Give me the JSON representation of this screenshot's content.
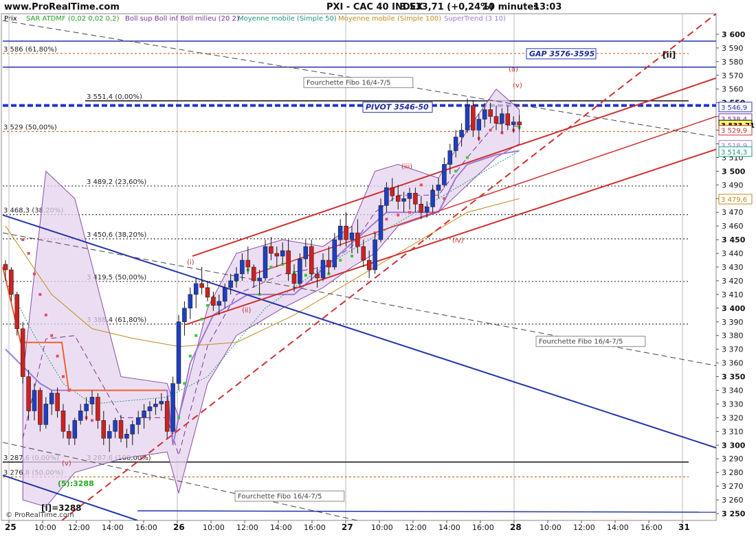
{
  "header": {
    "site": "www.ProRealTime.com",
    "title": "PXI - CAC 40 INDEX",
    "last": "3 533,71 (+0,24%)",
    "timeframe": "10 minutes",
    "time": "13:03"
  },
  "legend": [
    {
      "label": "Prix",
      "color": "#000000"
    },
    {
      "label": "SAR ATDMF (0,02 0,02 0,2)",
      "color": "#22a022"
    },
    {
      "label": "Boll sup Boll inf Boll milieu (20 2)",
      "color": "#7a2f9a"
    },
    {
      "label": "Moyenne mobile (Simple 50)",
      "color": "#1a9a7a"
    },
    {
      "label": "Moyenne mobile (Simple 100)",
      "color": "#c08a1a"
    },
    {
      "label": "SuperTrend (3 10)",
      "color": "#9a7ad8"
    }
  ],
  "copyright": "© ProRealTime.com",
  "chart_data": {
    "type": "candlestick",
    "ylim": [
      3245,
      3615
    ],
    "y_ticks": [
      3250,
      3260,
      3270,
      3280,
      3290,
      3300,
      3310,
      3320,
      3330,
      3340,
      3350,
      3360,
      3370,
      3380,
      3390,
      3400,
      3410,
      3420,
      3430,
      3440,
      3450,
      3460,
      3470,
      3480,
      3490,
      3500,
      3510,
      3520,
      3530,
      3540,
      3550,
      3560,
      3570,
      3580,
      3590,
      3600
    ],
    "x_ticks": [
      {
        "label": "25",
        "bold": true
      },
      {
        "label": "10:00"
      },
      {
        "label": "12:00"
      },
      {
        "label": "14:00"
      },
      {
        "label": "16:00"
      },
      {
        "label": "26",
        "bold": true
      },
      {
        "label": "10:00"
      },
      {
        "label": "12:00"
      },
      {
        "label": "14:00"
      },
      {
        "label": "16:00"
      },
      {
        "label": "27",
        "bold": true
      },
      {
        "label": "10:00"
      },
      {
        "label": "12:00"
      },
      {
        "label": "14:00"
      },
      {
        "label": "16:00"
      },
      {
        "label": "28",
        "bold": true
      },
      {
        "label": "10:00"
      },
      {
        "label": "12:00"
      },
      {
        "label": "14:00"
      },
      {
        "label": "16:00"
      },
      {
        "label": "31",
        "bold": true
      }
    ],
    "candles": [
      [
        3432,
        3435,
        3420,
        3428
      ],
      [
        3428,
        3430,
        3405,
        3410
      ],
      [
        3410,
        3412,
        3380,
        3385
      ],
      [
        3385,
        3390,
        3345,
        3350
      ],
      [
        3350,
        3355,
        3318,
        3325
      ],
      [
        3325,
        3345,
        3318,
        3340
      ],
      [
        3340,
        3342,
        3310,
        3315
      ],
      [
        3315,
        3335,
        3312,
        3330
      ],
      [
        3330,
        3340,
        3322,
        3338
      ],
      [
        3338,
        3342,
        3320,
        3325
      ],
      [
        3325,
        3330,
        3305,
        3310
      ],
      [
        3310,
        3315,
        3300,
        3305
      ],
      [
        3305,
        3320,
        3300,
        3318
      ],
      [
        3318,
        3330,
        3315,
        3325
      ],
      [
        3325,
        3335,
        3318,
        3330
      ],
      [
        3330,
        3340,
        3322,
        3335
      ],
      [
        3335,
        3338,
        3312,
        3318
      ],
      [
        3318,
        3325,
        3300,
        3305
      ],
      [
        3305,
        3315,
        3295,
        3310
      ],
      [
        3310,
        3320,
        3305,
        3318
      ],
      [
        3318,
        3322,
        3302,
        3305
      ],
      [
        3305,
        3312,
        3298,
        3308
      ],
      [
        3308,
        3318,
        3300,
        3315
      ],
      [
        3315,
        3325,
        3308,
        3320
      ],
      [
        3320,
        3330,
        3312,
        3325
      ],
      [
        3325,
        3332,
        3318,
        3328
      ],
      [
        3328,
        3334,
        3322,
        3330
      ],
      [
        3330,
        3338,
        3325,
        3332
      ],
      [
        3332,
        3336,
        3305,
        3310
      ],
      [
        3310,
        3350,
        3308,
        3345
      ],
      [
        3345,
        3395,
        3340,
        3390
      ],
      [
        3390,
        3405,
        3380,
        3400
      ],
      [
        3400,
        3415,
        3392,
        3410
      ],
      [
        3410,
        3422,
        3400,
        3418
      ],
      [
        3418,
        3430,
        3410,
        3415
      ],
      [
        3415,
        3420,
        3405,
        3408
      ],
      [
        3408,
        3412,
        3398,
        3402
      ],
      [
        3402,
        3410,
        3395,
        3405
      ],
      [
        3405,
        3418,
        3400,
        3415
      ],
      [
        3415,
        3425,
        3410,
        3420
      ],
      [
        3420,
        3430,
        3415,
        3425
      ],
      [
        3425,
        3440,
        3420,
        3435
      ],
      [
        3435,
        3445,
        3425,
        3430
      ],
      [
        3430,
        3432,
        3415,
        3420
      ],
      [
        3420,
        3428,
        3410,
        3422
      ],
      [
        3422,
        3450,
        3420,
        3445
      ],
      [
        3445,
        3452,
        3435,
        3440
      ],
      [
        3440,
        3445,
        3430,
        3438
      ],
      [
        3438,
        3448,
        3432,
        3442
      ],
      [
        3442,
        3450,
        3420,
        3425
      ],
      [
        3425,
        3432,
        3412,
        3418
      ],
      [
        3418,
        3440,
        3415,
        3436
      ],
      [
        3436,
        3450,
        3430,
        3445
      ],
      [
        3445,
        3450,
        3420,
        3425
      ],
      [
        3425,
        3430,
        3415,
        3422
      ],
      [
        3422,
        3440,
        3420,
        3435
      ],
      [
        3435,
        3445,
        3425,
        3430
      ],
      [
        3430,
        3455,
        3428,
        3450
      ],
      [
        3450,
        3465,
        3445,
        3460
      ],
      [
        3460,
        3470,
        3445,
        3450
      ],
      [
        3450,
        3460,
        3440,
        3455
      ],
      [
        3455,
        3465,
        3440,
        3445
      ],
      [
        3445,
        3450,
        3430,
        3435
      ],
      [
        3435,
        3442,
        3422,
        3428
      ],
      [
        3428,
        3455,
        3425,
        3450
      ],
      [
        3450,
        3480,
        3448,
        3475
      ],
      [
        3475,
        3492,
        3470,
        3488
      ],
      [
        3488,
        3495,
        3478,
        3482
      ],
      [
        3482,
        3490,
        3472,
        3478
      ],
      [
        3478,
        3485,
        3470,
        3480
      ],
      [
        3480,
        3488,
        3472,
        3484
      ],
      [
        3484,
        3488,
        3470,
        3476
      ],
      [
        3476,
        3482,
        3465,
        3470
      ],
      [
        3470,
        3478,
        3466,
        3474
      ],
      [
        3474,
        3490,
        3470,
        3486
      ],
      [
        3486,
        3495,
        3480,
        3490
      ],
      [
        3490,
        3510,
        3488,
        3505
      ],
      [
        3505,
        3520,
        3498,
        3515
      ],
      [
        3515,
        3530,
        3510,
        3525
      ],
      [
        3525,
        3535,
        3518,
        3530
      ],
      [
        3530,
        3553,
        3528,
        3548
      ],
      [
        3548,
        3552,
        3525,
        3530
      ],
      [
        3530,
        3542,
        3522,
        3538
      ],
      [
        3538,
        3550,
        3532,
        3545
      ],
      [
        3545,
        3550,
        3535,
        3540
      ],
      [
        3540,
        3548,
        3530,
        3535
      ],
      [
        3535,
        3546,
        3528,
        3542
      ],
      [
        3542,
        3548,
        3530,
        3534
      ],
      [
        3534,
        3540,
        3528,
        3536
      ],
      [
        3536,
        3541,
        3530,
        3533.71
      ]
    ],
    "bollinger_upper": [
      [
        3,
        3350
      ],
      [
        7,
        3500
      ],
      [
        12,
        3480
      ],
      [
        20,
        3350
      ],
      [
        28,
        3345
      ],
      [
        30,
        3320
      ],
      [
        35,
        3400
      ],
      [
        40,
        3440
      ],
      [
        48,
        3450
      ],
      [
        55,
        3445
      ],
      [
        60,
        3460
      ],
      [
        64,
        3500
      ],
      [
        68,
        3505
      ],
      [
        75,
        3495
      ],
      [
        80,
        3530
      ],
      [
        85,
        3560
      ],
      [
        89,
        3545
      ]
    ],
    "bollinger_lower": [
      [
        3,
        3260
      ],
      [
        7,
        3255
      ],
      [
        12,
        3280
      ],
      [
        20,
        3290
      ],
      [
        28,
        3295
      ],
      [
        30,
        3265
      ],
      [
        35,
        3345
      ],
      [
        40,
        3380
      ],
      [
        48,
        3400
      ],
      [
        55,
        3415
      ],
      [
        60,
        3430
      ],
      [
        64,
        3440
      ],
      [
        68,
        3460
      ],
      [
        75,
        3470
      ],
      [
        80,
        3490
      ],
      [
        85,
        3510
      ],
      [
        89,
        3520
      ]
    ],
    "sma50": [
      [
        0,
        3420
      ],
      [
        5,
        3380
      ],
      [
        10,
        3345
      ],
      [
        15,
        3330
      ],
      [
        20,
        3332
      ],
      [
        28,
        3335
      ],
      [
        35,
        3350
      ],
      [
        45,
        3400
      ],
      [
        55,
        3430
      ],
      [
        65,
        3455
      ],
      [
        75,
        3480
      ],
      [
        85,
        3505
      ],
      [
        89,
        3515
      ]
    ],
    "sma100": [
      [
        0,
        3460
      ],
      [
        8,
        3410
      ],
      [
        15,
        3385
      ],
      [
        22,
        3378
      ],
      [
        30,
        3372
      ],
      [
        40,
        3375
      ],
      [
        50,
        3395
      ],
      [
        60,
        3420
      ],
      [
        70,
        3445
      ],
      [
        80,
        3470
      ],
      [
        89,
        3480
      ]
    ],
    "supertrend": [
      [
        0,
        3370
      ],
      [
        6,
        3345
      ],
      [
        8,
        3340
      ],
      [
        28,
        3340
      ],
      [
        29,
        3300
      ],
      [
        32,
        3360
      ],
      [
        36,
        3395
      ],
      [
        42,
        3410
      ],
      [
        50,
        3410
      ],
      [
        58,
        3440
      ],
      [
        66,
        3470
      ],
      [
        75,
        3470
      ],
      [
        78,
        3495
      ],
      [
        80,
        3505
      ],
      [
        85,
        3512
      ],
      [
        89,
        3515
      ]
    ],
    "sar_points": [
      [
        3,
        3450
      ],
      [
        4,
        3440
      ],
      [
        5,
        3425
      ],
      [
        6,
        3410
      ],
      [
        7,
        3395
      ],
      [
        8,
        3380
      ],
      [
        9,
        3365
      ],
      [
        10,
        3350
      ],
      [
        11,
        3340
      ],
      [
        14,
        3320
      ],
      [
        15,
        3318
      ],
      [
        16,
        3320
      ],
      [
        30,
        3320
      ],
      [
        31,
        3345
      ],
      [
        32,
        3365
      ],
      [
        33,
        3380
      ],
      [
        34,
        3392
      ],
      [
        35,
        3402
      ],
      [
        36,
        3408
      ],
      [
        38,
        3410
      ],
      [
        40,
        3420
      ],
      [
        42,
        3428
      ],
      [
        44,
        3410
      ],
      [
        46,
        3430
      ],
      [
        48,
        3432
      ],
      [
        50,
        3426
      ],
      [
        52,
        3424
      ],
      [
        56,
        3425
      ],
      [
        58,
        3435
      ],
      [
        60,
        3438
      ],
      [
        62,
        3442
      ],
      [
        64,
        3455
      ],
      [
        66,
        3465
      ],
      [
        68,
        3468
      ],
      [
        70,
        3470
      ],
      [
        72,
        3490
      ],
      [
        74,
        3486
      ],
      [
        76,
        3480
      ],
      [
        78,
        3500
      ],
      [
        80,
        3510
      ],
      [
        82,
        3524
      ],
      [
        84,
        3530
      ],
      [
        86,
        3528
      ],
      [
        88,
        3530
      ],
      [
        89,
        3532
      ]
    ],
    "fibo_levels": [
      {
        "value": 3551.4,
        "label": "3 551,4 (0,00%)",
        "style": "solid"
      },
      {
        "value": 3529,
        "label": "3 529 (50,00%)",
        "style": "dotted-orange"
      },
      {
        "value": 3489.2,
        "label": "3 489,2 (23,60%)",
        "style": "dotted"
      },
      {
        "value": 3468.3,
        "label": "3 468,3 (38,20%)",
        "style": "dotted"
      },
      {
        "value": 3450.6,
        "label": "3 450,6 (38,20%)",
        "style": "dotted"
      },
      {
        "value": 3419.5,
        "label": "3 419,5 (50,00%)",
        "style": "dotted"
      },
      {
        "value": 3388.4,
        "label": "3 388,4 (61,80%)",
        "style": "dotted"
      },
      {
        "value": 3287.6,
        "label": "3 287,6 (100,00%)",
        "style": "solid"
      },
      {
        "value": 3287.6,
        "label": "3 287,6 (0,00%)",
        "style": "none"
      },
      {
        "value": 3276.8,
        "label": "3 276,8 (50,00%)",
        "style": "dotted-orange"
      },
      {
        "value": 3586,
        "label": "3 586 (61,80%)",
        "style": "dotted-orange"
      }
    ],
    "annotations": [
      {
        "text": "GAP 3576-3595",
        "kind": "box-blue"
      },
      {
        "text": "PIVOT 3546-50",
        "kind": "box-blue"
      },
      {
        "text": "Fourchette Fibo 16/4-7/5",
        "kind": "box-gray"
      },
      {
        "text": "Fourchette Fibo 16/4-7/5",
        "kind": "box-gray"
      },
      {
        "text": "Fourchette Fibo 16/4-7/5",
        "kind": "box-gray"
      },
      {
        "text": "[ii]",
        "kind": "bold"
      },
      {
        "text": "[i]=3288",
        "kind": "bold"
      },
      {
        "text": "(5):3288",
        "kind": "green"
      },
      {
        "text": "(a)",
        "kind": "wave"
      },
      {
        "text": "(i)",
        "kind": "wave"
      },
      {
        "text": "(ii)",
        "kind": "wave"
      },
      {
        "text": "(iii)",
        "kind": "wave"
      },
      {
        "text": "(iv)",
        "kind": "wave"
      },
      {
        "text": "(v)",
        "kind": "wave"
      },
      {
        "text": "(v)",
        "kind": "wave"
      }
    ],
    "price_tags": [
      {
        "text": "3 546,9",
        "color": "#2233bb"
      },
      {
        "text": "3 538,4",
        "color": "#7a2f9a"
      },
      {
        "text": "3 533,71",
        "color": "#000000"
      },
      {
        "text": "3 529,9",
        "color": "#c03030"
      },
      {
        "text": "3 518,9",
        "color": "#9a7ad8"
      },
      {
        "text": "3 514,3",
        "color": "#1a9a7a"
      },
      {
        "text": "3 479,6",
        "color": "#c08a1a"
      }
    ]
  }
}
